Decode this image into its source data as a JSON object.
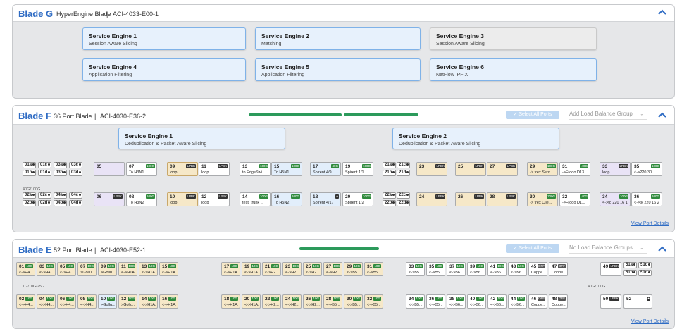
{
  "blades": [
    {
      "name": "Blade G",
      "type": "HyperEngine Blade",
      "sep": "|",
      "model": "ACI-4033-E00-1"
    },
    {
      "name": "Blade F",
      "type": "36 Port Blade",
      "sep": "|",
      "model": "ACI-4030-E36-2",
      "select_all": "✓ Select All Ports",
      "dropdown": "Add Load Balance Group",
      "view_details": "View Port Details",
      "speed": "40G/100G"
    },
    {
      "name": "Blade E",
      "type": "52 Port Blade",
      "sep": "|",
      "model": "ACI-4030-E52-1",
      "select_all": "✓ Select All Ports",
      "dropdown": "No Load Balance Groups",
      "view_details": "View Port Details",
      "speed_left": "1G/10G/25G",
      "speed_right": "40G/100G"
    }
  ],
  "engines_g": [
    {
      "title": "Service Engine 1",
      "sub": "Session Aware Slicing"
    },
    {
      "title": "Service Engine 2",
      "sub": "Matching"
    },
    {
      "title": "Service Engine 3",
      "sub": "Session Aware Slicing"
    },
    {
      "title": "Service Engine 4",
      "sub": "Application Filtering"
    },
    {
      "title": "Service Engine 5",
      "sub": "Application Filtering"
    },
    {
      "title": "Service Engine 6",
      "sub": "NetFlow IPFIX"
    }
  ],
  "engines_f": [
    {
      "title": "Service Engine 1",
      "sub": "Deduplication & Packet Aware Slicing"
    },
    {
      "title": "Service Engine 2",
      "sub": "Deduplication & Packet Aware Slicing"
    }
  ],
  "f_split": {
    "top": [
      "01a",
      "01c",
      "03a",
      "03c"
    ],
    "bot": [
      "01b",
      "01d",
      "03b",
      "03d"
    ],
    "top2": [
      "02a",
      "02c",
      "04a",
      "04c"
    ],
    "bot2": [
      "02b",
      "02d",
      "04b",
      "04d"
    ],
    "top3": [
      "21a",
      "21c"
    ],
    "bot3": [
      "21b",
      "21d"
    ],
    "top4": [
      "22a",
      "22c"
    ],
    "bot4": [
      "22b",
      "22d"
    ],
    "e_top": [
      "51a",
      "51c"
    ],
    "e_bot": [
      "51b",
      "51d"
    ]
  },
  "f_ports_row1": [
    {
      "n": "05",
      "b": "",
      "d": ""
    },
    {
      "n": "07",
      "b": "100G",
      "d": "To H3N1"
    },
    {
      "n": "09",
      "b": "LPBK",
      "d": "loop"
    },
    {
      "n": "11",
      "b": "LPBK",
      "d": "loop"
    },
    {
      "n": "13",
      "b": "100G",
      "d": "to EdgeSwi..."
    },
    {
      "n": "15",
      "b": "100G",
      "d": "To H5N1"
    },
    {
      "n": "17",
      "b": "40G",
      "d": "Spirent 4/9"
    },
    {
      "n": "19",
      "b": "100G",
      "d": "Spirent 1/1"
    },
    {
      "n": "23",
      "b": "LPBK",
      "d": ""
    },
    {
      "n": "25",
      "b": "LPBK",
      "d": ""
    },
    {
      "n": "27",
      "b": "LPBK",
      "d": ""
    },
    {
      "n": "29",
      "b": "100G",
      "d": "-> trex Serv..."
    },
    {
      "n": "31",
      "b": "40G",
      "d": "->Frodo D13"
    },
    {
      "n": "33",
      "b": "LPBK",
      "d": "loop"
    },
    {
      "n": "35",
      "b": "100G",
      "d": "<->220 30 ..."
    }
  ],
  "f_ports_row2": [
    {
      "n": "06",
      "b": "LPBK",
      "d": ""
    },
    {
      "n": "08",
      "b": "100G",
      "d": "To H3N2"
    },
    {
      "n": "10",
      "b": "LPBK",
      "d": "loop"
    },
    {
      "n": "12",
      "b": "LPBK",
      "d": "loop"
    },
    {
      "n": "14",
      "b": "100G",
      "d": "test_trunk ..."
    },
    {
      "n": "16",
      "b": "100G",
      "d": "To H5N2"
    },
    {
      "n": "18",
      "b": "●",
      "d": "Spirent 4/17"
    },
    {
      "n": "20",
      "b": "100G",
      "d": "Spirent 1/2"
    },
    {
      "n": "24",
      "b": "LPBK",
      "d": ""
    },
    {
      "n": "26",
      "b": "LPBK",
      "d": ""
    },
    {
      "n": "28",
      "b": "LPBK",
      "d": ""
    },
    {
      "n": "30",
      "b": "100G",
      "d": "-> trex Clie..."
    },
    {
      "n": "32",
      "b": "40G",
      "d": "->Frodo D1..."
    },
    {
      "n": "34",
      "b": "100G",
      "d": "<->to 220 16 1"
    },
    {
      "n": "36",
      "b": "100G",
      "d": "<->to 220 16 2"
    }
  ],
  "e_ports_row1": [
    {
      "n": "01",
      "b": "10G",
      "d": "<->H4..."
    },
    {
      "n": "03",
      "b": "10G",
      "d": "<->H4..."
    },
    {
      "n": "05",
      "b": "10G",
      "d": "<->H4..."
    },
    {
      "n": "07",
      "b": "10G",
      "d": ">Gollu..."
    },
    {
      "n": "09",
      "b": "10G",
      "d": ">Gollu..."
    },
    {
      "n": "11",
      "b": "10G",
      "d": "<->H1A..."
    },
    {
      "n": "13",
      "b": "10G",
      "d": "<->H1A..."
    },
    {
      "n": "15",
      "b": "10G",
      "d": "<->H1A..."
    },
    {
      "n": "17",
      "b": "10G",
      "d": "<->H1A..."
    },
    {
      "n": "19",
      "b": "10G",
      "d": "<->H1A..."
    },
    {
      "n": "21",
      "b": "10G",
      "d": "<->H2..."
    },
    {
      "n": "23",
      "b": "10G",
      "d": "<->H2..."
    },
    {
      "n": "25",
      "b": "10G",
      "d": "<->H2..."
    },
    {
      "n": "27",
      "b": "10G",
      "d": "<->H2..."
    },
    {
      "n": "29",
      "b": "10G",
      "d": "<->B5..."
    },
    {
      "n": "31",
      "b": "10G",
      "d": "<->B5..."
    },
    {
      "n": "33",
      "b": "10G",
      "d": "<->B5..."
    },
    {
      "n": "35",
      "b": "10G",
      "d": "<->B5..."
    },
    {
      "n": "37",
      "b": "10G",
      "d": "<->B6..."
    },
    {
      "n": "39",
      "b": "10G",
      "d": "<->B6..."
    },
    {
      "n": "41",
      "b": "10G",
      "d": "<->B6..."
    },
    {
      "n": "43",
      "b": "10G",
      "d": "<->B6..."
    },
    {
      "n": "45",
      "b": "OFF",
      "d": "Coppe..."
    },
    {
      "n": "47",
      "b": "OFF",
      "d": "Coppe..."
    }
  ],
  "e_ports_row2": [
    {
      "n": "02",
      "b": "10G",
      "d": "<->H4..."
    },
    {
      "n": "04",
      "b": "10G",
      "d": "<->H4..."
    },
    {
      "n": "06",
      "b": "10G",
      "d": "<->H4..."
    },
    {
      "n": "08",
      "b": "10G",
      "d": "<->H4..."
    },
    {
      "n": "10",
      "b": "10G",
      "d": ">Gollu..."
    },
    {
      "n": "12",
      "b": "10G",
      "d": ">Gollu..."
    },
    {
      "n": "14",
      "b": "10G",
      "d": "<->H1A..."
    },
    {
      "n": "16",
      "b": "10G",
      "d": "<->H1A..."
    },
    {
      "n": "18",
      "b": "10G",
      "d": "<->H1A..."
    },
    {
      "n": "20",
      "b": "10G",
      "d": "<->H1A..."
    },
    {
      "n": "22",
      "b": "10G",
      "d": "<->H2..."
    },
    {
      "n": "24",
      "b": "10G",
      "d": "<->H2..."
    },
    {
      "n": "26",
      "b": "10G",
      "d": "<->H2..."
    },
    {
      "n": "28",
      "b": "10G",
      "d": "<->B5..."
    },
    {
      "n": "30",
      "b": "10G",
      "d": "<->B5..."
    },
    {
      "n": "32",
      "b": "10G",
      "d": "<->B5..."
    },
    {
      "n": "34",
      "b": "10G",
      "d": "<->B5..."
    },
    {
      "n": "36",
      "b": "10G",
      "d": "<->B5..."
    },
    {
      "n": "38",
      "b": "10G",
      "d": "<->B6..."
    },
    {
      "n": "40",
      "b": "10G",
      "d": "<->B6..."
    },
    {
      "n": "42",
      "b": "10G",
      "d": "<->B6..."
    },
    {
      "n": "44",
      "b": "10G",
      "d": "<->B6..."
    },
    {
      "n": "46",
      "b": "OFF",
      "d": "Coppe..."
    },
    {
      "n": "48",
      "b": "OFF",
      "d": "Coppe..."
    }
  ],
  "e_right": {
    "p49": "49",
    "p49b": "LPBK",
    "p50": "50",
    "p50b": "LPBK",
    "p52": "52",
    "p52b": "●"
  }
}
